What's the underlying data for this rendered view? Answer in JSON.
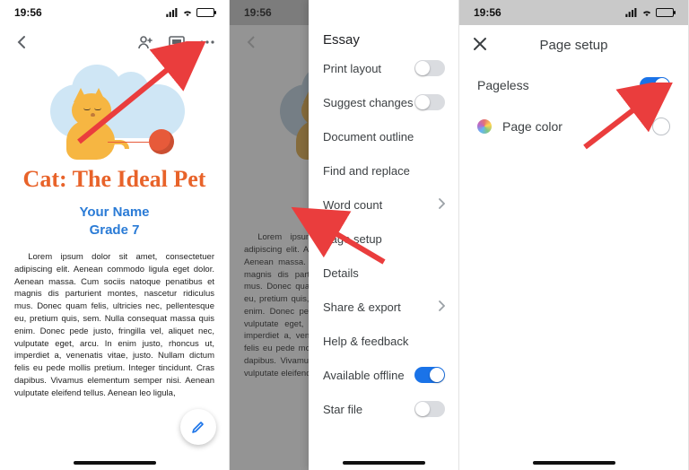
{
  "status": {
    "time": "19:56",
    "location_on": true
  },
  "colors": {
    "accent_blue": "#1a73e8",
    "title_orange": "#e8632a",
    "link_blue": "#2a7bd6",
    "arrow_red": "#ea3d3d"
  },
  "doc": {
    "title": "Cat: The Ideal Pet",
    "your_name": "Your Name",
    "grade": "Grade 7",
    "body": "Lorem ipsum dolor sit amet, consectetuer adipiscing elit. Aenean commodo ligula eget dolor. Aenean massa. Cum sociis natoque penatibus et magnis dis parturient montes, nascetur ridiculus mus. Donec quam felis, ultricies nec, pellentesque eu, pretium quis, sem. Nulla consequat massa quis enim. Donec pede justo, fringilla vel, aliquet nec, vulputate eget, arcu. In enim justo, rhoncus ut, imperdiet a, venenatis vitae, justo. Nullam dictum felis eu pede mollis pretium. Integer tincidunt. Cras dapibus. Vivamus elementum semper nisi. Aenean vulputate eleifend tellus. Aenean leo ligula,"
  },
  "menu": {
    "title": "Essay",
    "items": [
      {
        "label": "Print layout",
        "accessory": "toggle",
        "on": false
      },
      {
        "label": "Suggest changes",
        "accessory": "toggle",
        "on": false
      },
      {
        "label": "Document outline",
        "accessory": "none"
      },
      {
        "label": "Find and replace",
        "accessory": "none"
      },
      {
        "label": "Word count",
        "accessory": "chevron"
      },
      {
        "label": "Page setup",
        "accessory": "none"
      },
      {
        "label": "Details",
        "accessory": "none"
      },
      {
        "label": "Share & export",
        "accessory": "chevron"
      },
      {
        "label": "Help & feedback",
        "accessory": "none"
      },
      {
        "label": "Available offline",
        "accessory": "toggle",
        "on": true
      },
      {
        "label": "Star file",
        "accessory": "toggle",
        "on": false
      }
    ]
  },
  "page_setup": {
    "title": "Page setup",
    "pageless_label": "Pageless",
    "pageless_on": true,
    "page_color_label": "Page color"
  }
}
